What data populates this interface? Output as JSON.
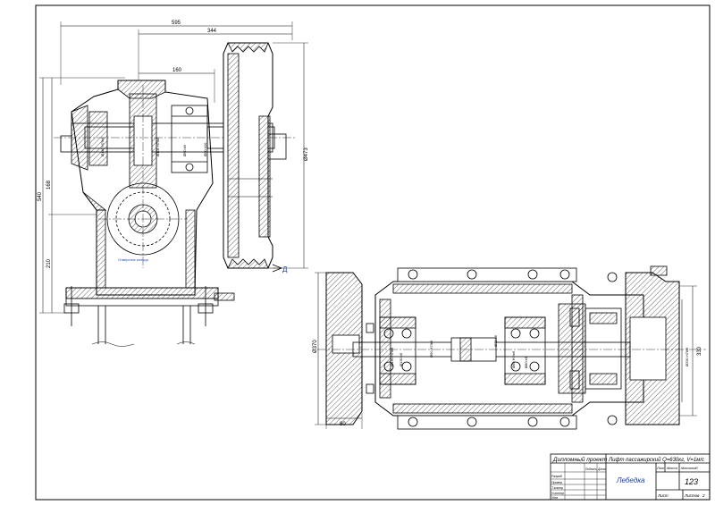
{
  "dimensions": {
    "overall_width": "595",
    "to_pulley": "344",
    "shaft_center": "160",
    "height": "540",
    "upper": "168",
    "lower": "210",
    "pulley_diam": "Ø473",
    "left_flange": "Ø370",
    "flange_thickness": "80",
    "bore_right": "Ø290 H7/k6",
    "height_right": "330",
    "fit_1": "Ø140 H7/k6",
    "fit_2": "Ø105 H7/k6",
    "fit_3": "Ø50 k6",
    "fit_4": "Ø90 h10",
    "fit_5": "Ø130 H7/k6",
    "fit_6": "Ø130 k6",
    "fit_7": "Ø90 H7/k6",
    "fit_8": "Ø75 k6",
    "fit_9": "Ø60 H7/n6",
    "fit_10": "Ø80 k6"
  },
  "annotations": {
    "view_marker": "Д",
    "note_label": "Отверстие кольца"
  },
  "title_block": {
    "header": "Дипломный проект",
    "description": "Лифт пассажирский Q=630кг, V=1м/с",
    "title": "Лебедка",
    "sheet_number": "123",
    "col_lit": "Лит",
    "col_mass": "Масса",
    "col_scale": "Масштаб",
    "sheet_label": "Лист",
    "sheets_label": "Листов",
    "sheets_count": "2",
    "role_designer": "Разраб",
    "role_checker": "Провер",
    "role_tcontrol": "Т.контр",
    "role_ncontrol": "Н.контр",
    "role_approved": "Утв",
    "col_signature": "Подпись",
    "col_date": "Дата"
  },
  "colors": {
    "line": "#000000",
    "accent": "#1a3fb0"
  }
}
